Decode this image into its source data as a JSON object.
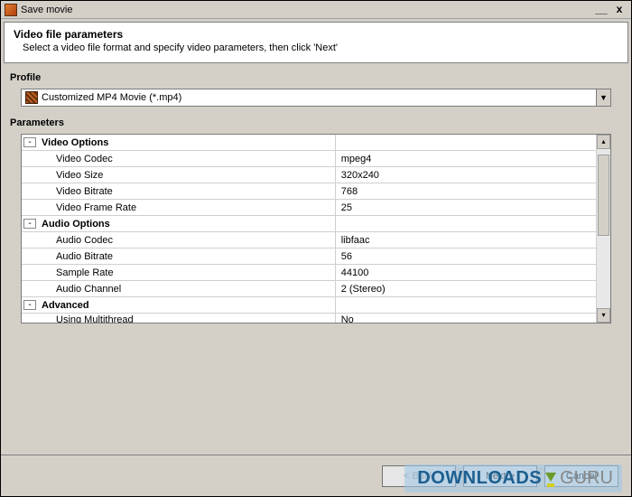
{
  "titlebar": {
    "title": "Save movie",
    "minimize": "__",
    "close": "x"
  },
  "banner": {
    "heading": "Video file parameters",
    "sub": "Select a video file format and specify video parameters, then click 'Next'"
  },
  "profile": {
    "label": "Profile",
    "selected": "Customized MP4 Movie (*.mp4)"
  },
  "parameters": {
    "label": "Parameters",
    "groups": [
      {
        "name": "Video Options",
        "expanded": true,
        "rows": [
          {
            "name": "Video Codec",
            "value": "mpeg4"
          },
          {
            "name": "Video Size",
            "value": "320x240"
          },
          {
            "name": "Video Bitrate",
            "value": "768"
          },
          {
            "name": "Video Frame Rate",
            "value": "25"
          }
        ]
      },
      {
        "name": "Audio Options",
        "expanded": true,
        "rows": [
          {
            "name": "Audio Codec",
            "value": "libfaac"
          },
          {
            "name": "Audio Bitrate",
            "value": "56"
          },
          {
            "name": "Sample Rate",
            "value": "44100"
          },
          {
            "name": "Audio Channel",
            "value": "2 (Stereo)"
          }
        ]
      },
      {
        "name": "Advanced",
        "expanded": true,
        "rows": [
          {
            "name": "Using Multithread",
            "value": "No"
          }
        ]
      }
    ]
  },
  "buttons": {
    "back": "< Back",
    "next": "Next >",
    "cancel": "Cancel"
  },
  "watermark": {
    "part1": "DOWNLOADS",
    "part2": "GURU"
  }
}
